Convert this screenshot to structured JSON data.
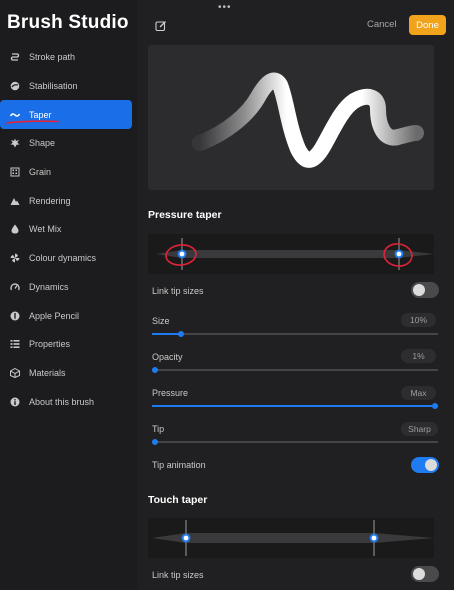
{
  "app": {
    "title": "Brush Studio"
  },
  "toolbar": {
    "drag_handle": "•••",
    "cancel_label": "Cancel",
    "done_label": "Done"
  },
  "sidebar": {
    "items": [
      {
        "label": "Stroke path",
        "icon": "stroke-path-icon"
      },
      {
        "label": "Stabilisation",
        "icon": "stabilisation-icon"
      },
      {
        "label": "Taper",
        "icon": "taper-icon",
        "active": true
      },
      {
        "label": "Shape",
        "icon": "shape-icon"
      },
      {
        "label": "Grain",
        "icon": "grain-icon"
      },
      {
        "label": "Rendering",
        "icon": "rendering-icon"
      },
      {
        "label": "Wet Mix",
        "icon": "wet-mix-icon"
      },
      {
        "label": "Colour dynamics",
        "icon": "colour-dynamics-icon"
      },
      {
        "label": "Dynamics",
        "icon": "dynamics-icon"
      },
      {
        "label": "Apple Pencil",
        "icon": "apple-pencil-icon"
      },
      {
        "label": "Properties",
        "icon": "properties-icon"
      },
      {
        "label": "Materials",
        "icon": "materials-icon"
      },
      {
        "label": "About this brush",
        "icon": "about-icon"
      }
    ]
  },
  "pressure_taper": {
    "title": "Pressure taper",
    "taper_start": 0.1,
    "taper_end": 0.9,
    "link_tip_sizes": {
      "label": "Link tip sizes",
      "on": false
    },
    "size": {
      "label": "Size",
      "value": "10%",
      "level": 0.1
    },
    "opacity": {
      "label": "Opacity",
      "value": "1%",
      "level": 0.01
    },
    "pressure": {
      "label": "Pressure",
      "value": "Max",
      "level": 1.0
    },
    "tip": {
      "label": "Tip",
      "value": "Sharp",
      "level": 0.0
    },
    "tip_animation": {
      "label": "Tip animation",
      "on": true
    }
  },
  "touch_taper": {
    "title": "Touch taper",
    "taper_start": 0.1,
    "taper_end": 0.79,
    "link_tip_sizes": {
      "label": "Link tip sizes",
      "on": false
    }
  },
  "colors": {
    "accent": "#1f7cf0",
    "done": "#f1a31b",
    "annotation": "#e0233a"
  }
}
